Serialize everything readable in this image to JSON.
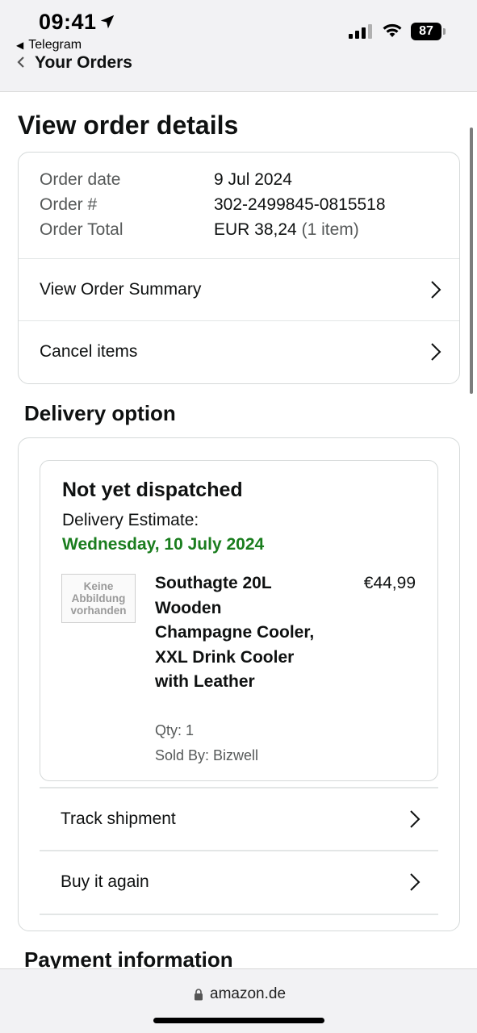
{
  "status_bar": {
    "time": "09:41",
    "back_app": "Telegram",
    "battery": "87"
  },
  "nav": {
    "title": "Your Orders"
  },
  "page": {
    "title": "View order details"
  },
  "order": {
    "date_label": "Order date",
    "date_value": "9 Jul 2024",
    "number_label": "Order #",
    "number_value": "302-2499845-0815518",
    "total_label": "Order Total",
    "total_value": "EUR 38,24",
    "total_items": "(1 item)",
    "summary_link": "View Order Summary",
    "cancel_link": "Cancel items"
  },
  "delivery": {
    "heading": "Delivery option",
    "status": "Not yet dispatched",
    "estimate_label": "Delivery Estimate:",
    "estimate_date": "Wednesday, 10 July 2024",
    "estimate_color": "#1a7d1e",
    "product": {
      "image_text": [
        "Keine",
        "Abbildung",
        "vorhanden"
      ],
      "title_lines": [
        "Southagte 20L",
        "Wooden",
        "Champagne Cooler,",
        "XXL Drink Cooler",
        "with Leather"
      ],
      "price": "€44,99",
      "qty": "Qty: 1",
      "seller": "Sold By: Bizwell"
    },
    "track_link": "Track shipment",
    "buy_again_link": "Buy it again"
  },
  "payment": {
    "heading": "Payment information"
  },
  "browser": {
    "url": "amazon.de"
  }
}
